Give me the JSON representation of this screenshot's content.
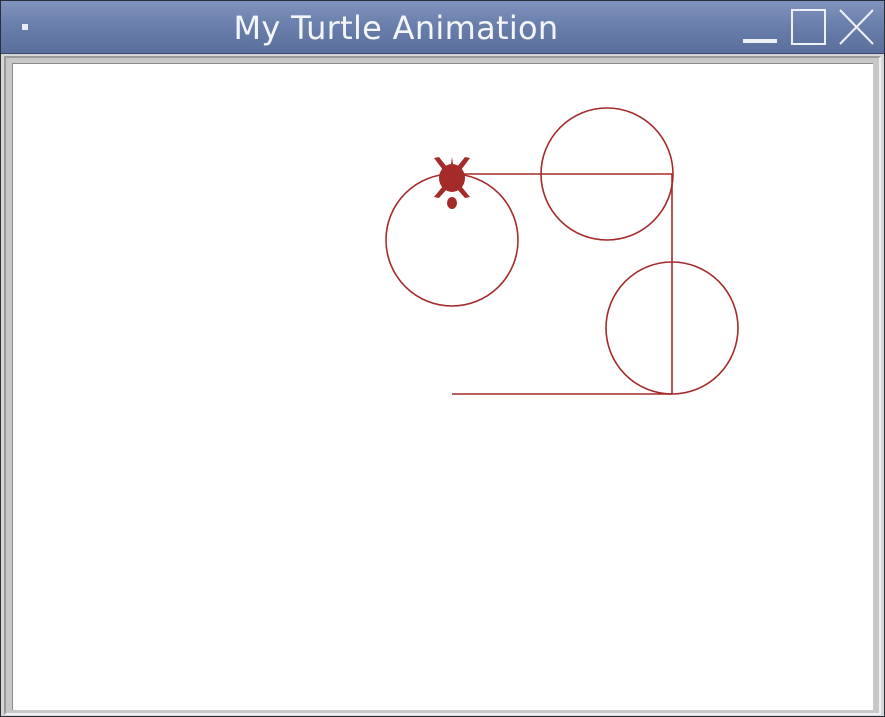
{
  "window": {
    "title": "My Turtle Animation"
  },
  "icons": {
    "menu": "window-menu-icon",
    "minimize": "minimize-icon",
    "maximize": "maximize-icon",
    "close": "close-icon"
  },
  "drawing": {
    "pen_color": "#a52a2a",
    "turtle_color": "#a52a2a",
    "background": "#ffffff"
  }
}
